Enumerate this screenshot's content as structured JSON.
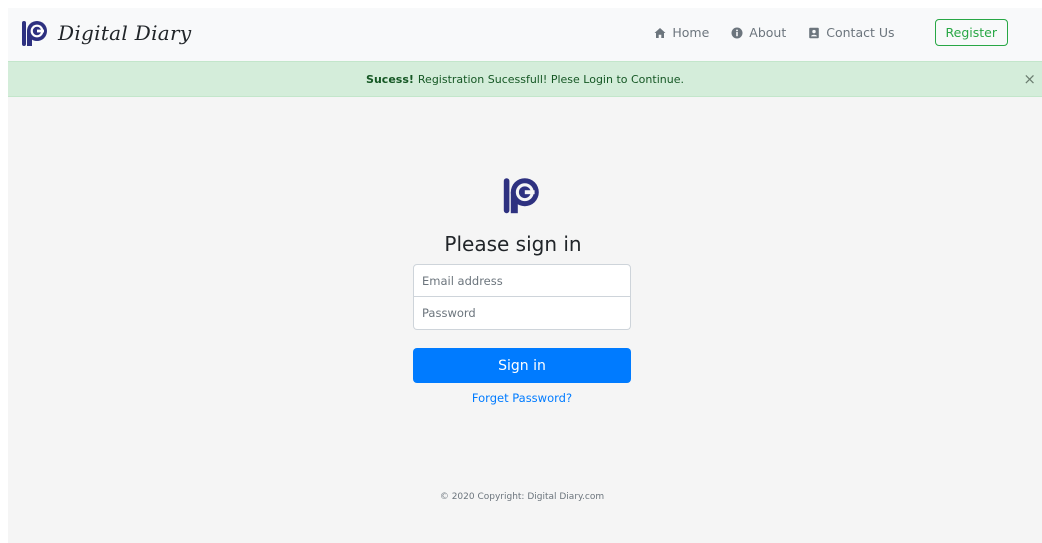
{
  "navbar": {
    "brand": "Digital Diary",
    "links": [
      {
        "label": "Home",
        "icon": "home-icon"
      },
      {
        "label": "About",
        "icon": "info-circle-icon"
      },
      {
        "label": "Contact Us",
        "icon": "address-book-icon"
      }
    ],
    "register_label": "Register"
  },
  "alert": {
    "strong": "Sucess!",
    "message": "Registration Sucessfull! Plese Login to Continue.",
    "close": "×"
  },
  "signin": {
    "title": "Please sign in",
    "email_placeholder": "Email address",
    "password_placeholder": "Password",
    "button_label": "Sign in",
    "forgot_label": "Forget Password?"
  },
  "footer": {
    "text": "© 2020 Copyright: Digital Diary.com"
  },
  "colors": {
    "brand": "#2e3180",
    "primary": "#007bff",
    "success": "#28a745",
    "alert_bg": "#d4edda",
    "alert_text": "#155724",
    "page_bg": "#f5f5f5"
  }
}
